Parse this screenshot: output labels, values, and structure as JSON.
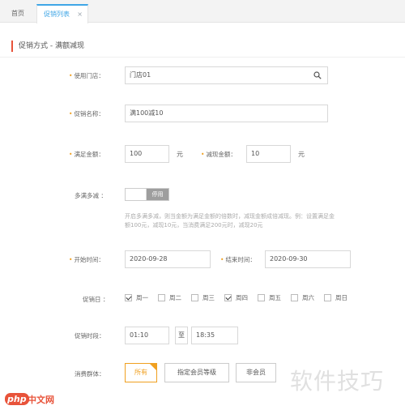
{
  "tabs": {
    "home": "首页",
    "active": "促销列表",
    "close": "×"
  },
  "section_title": "促销方式 - 满额减现",
  "form": {
    "store": {
      "label": "使用门店：",
      "value": "门店01"
    },
    "name": {
      "label": "促销名称：",
      "value": "满100减10"
    },
    "threshold": {
      "label": "满足金额：",
      "value": "100",
      "unit": "元"
    },
    "reduction": {
      "label": "减现金额：",
      "value": "10",
      "unit": "元"
    },
    "multi": {
      "label": "多满多减 ：",
      "state": "停用",
      "hint": "开启多满多减，则当金额为满足金额的倍数时，减现金额成倍减现。例：设置满足金额100元，减现10元，当消费满足200元时，减现20元"
    },
    "start": {
      "label": "开始时间：",
      "value": "2020-09-28"
    },
    "end": {
      "label": "结束时间：",
      "value": "2020-09-30"
    },
    "days": {
      "label": "促销日 ：",
      "items": [
        {
          "name": "周一",
          "checked": true
        },
        {
          "name": "周二",
          "checked": false
        },
        {
          "name": "周三",
          "checked": false
        },
        {
          "name": "周四",
          "checked": true
        },
        {
          "name": "周五",
          "checked": false
        },
        {
          "name": "周六",
          "checked": false
        },
        {
          "name": "周日",
          "checked": false
        }
      ]
    },
    "period": {
      "label": "促销时段：",
      "from": "01:10",
      "separator": "至",
      "to": "18:35"
    },
    "audience": {
      "label": "消费群体：",
      "options": [
        "所有",
        "指定会员等级",
        "非会员"
      ],
      "selected": "所有"
    }
  },
  "watermark": {
    "site_badge": "php",
    "site_name": "中文网",
    "text": "软件技巧"
  },
  "colors": {
    "accent_blue": "#3fa6e6",
    "accent_orange": "#f0a020",
    "accent_red": "#e8533a"
  }
}
